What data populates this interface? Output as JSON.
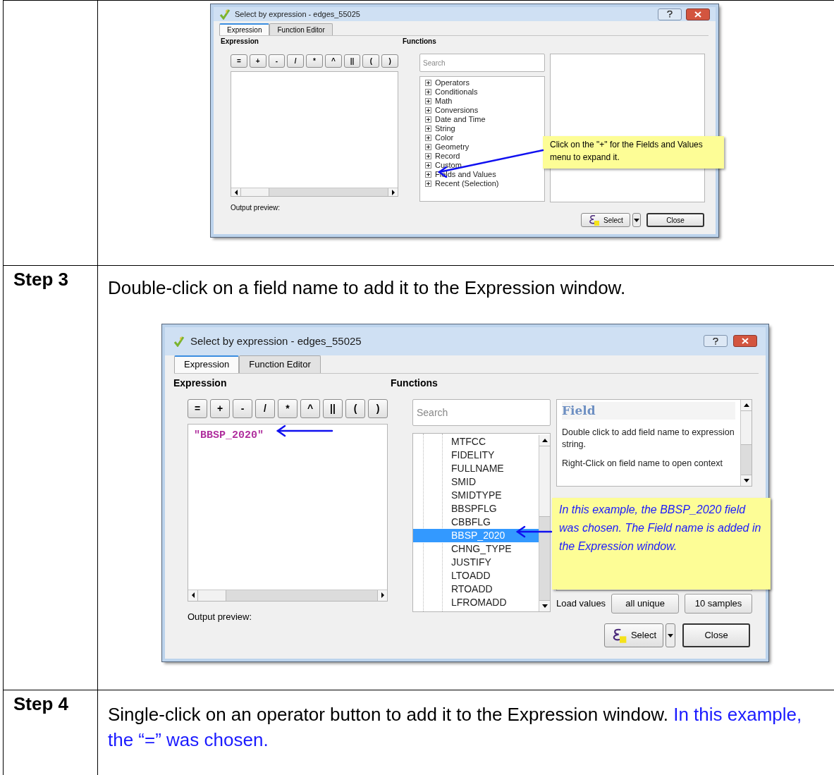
{
  "rows": [
    {
      "dialog": {
        "title": "Select by expression - edges_55025",
        "tabs": [
          {
            "label": "Expression",
            "selected": true
          },
          {
            "label": "Function Editor",
            "selected": false
          }
        ],
        "expression_label": "Expression",
        "functions_label": "Functions",
        "operators": [
          "=",
          "+",
          "-",
          "/",
          "*",
          "^",
          "||",
          "(",
          ")"
        ],
        "search": {
          "placeholder": "Search"
        },
        "tree": [
          {
            "kind": "group",
            "label": "Operators",
            "expanded": false
          },
          {
            "kind": "group",
            "label": "Conditionals",
            "expanded": false
          },
          {
            "kind": "group",
            "label": "Math",
            "expanded": false
          },
          {
            "kind": "group",
            "label": "Conversions",
            "expanded": false
          },
          {
            "kind": "group",
            "label": "Date and Time",
            "expanded": false
          },
          {
            "kind": "group",
            "label": "String",
            "expanded": false
          },
          {
            "kind": "group",
            "label": "Color",
            "expanded": false
          },
          {
            "kind": "group",
            "label": "Geometry",
            "expanded": false
          },
          {
            "kind": "group",
            "label": "Record",
            "expanded": false
          },
          {
            "kind": "group",
            "label": "Custom",
            "expanded": false
          },
          {
            "kind": "group",
            "label": "Fields and Values",
            "expanded": false
          },
          {
            "kind": "group",
            "label": "Recent (Selection)",
            "expanded": false
          }
        ],
        "output_preview_label": "Output preview:",
        "buttons": [
          "Select",
          "Close"
        ],
        "callout": "Click on the  \"+\" for the Fields and Values menu to expand it."
      }
    },
    {
      "step_label": "Step 3",
      "instruction": "Double-click on a field name to add it to the Expression window.",
      "dialog": {
        "title": "Select by expression - edges_55025",
        "tabs": [
          {
            "label": "Expression",
            "selected": true
          },
          {
            "label": "Function Editor",
            "selected": false
          }
        ],
        "expression_label": "Expression",
        "functions_label": "Functions",
        "operators": [
          "=",
          "+",
          "-",
          "/",
          "*",
          "^",
          "||",
          "(",
          ")"
        ],
        "expression_text": "\"BBSP_2020\"",
        "search": {
          "placeholder": "Search"
        },
        "tree": [
          {
            "kind": "field",
            "label": "MTFCC",
            "selected": false
          },
          {
            "kind": "field",
            "label": "FIDELITY",
            "selected": false
          },
          {
            "kind": "field",
            "label": "FULLNAME",
            "selected": false
          },
          {
            "kind": "field",
            "label": "SMID",
            "selected": false
          },
          {
            "kind": "field",
            "label": "SMIDTYPE",
            "selected": false
          },
          {
            "kind": "field",
            "label": "BBSPFLG",
            "selected": false
          },
          {
            "kind": "field",
            "label": "CBBFLG",
            "selected": false
          },
          {
            "kind": "field",
            "label": "BBSP_2020",
            "selected": true
          },
          {
            "kind": "field",
            "label": "CHNG_TYPE",
            "selected": false
          },
          {
            "kind": "field",
            "label": "JUSTIFY",
            "selected": false
          },
          {
            "kind": "field",
            "label": "LTOADD",
            "selected": false
          },
          {
            "kind": "field",
            "label": "RTOADD",
            "selected": false
          },
          {
            "kind": "field",
            "label": "LFROMADD",
            "selected": false
          }
        ],
        "help": {
          "heading": "Field",
          "paragraphs": [
            "Double click to add field name to expression string.",
            "Right-Click on field name to open context"
          ]
        },
        "load_values": {
          "label": "Load values",
          "buttons": [
            "all unique",
            "10 samples"
          ]
        },
        "output_preview_label": "Output preview:",
        "buttons": [
          "Select",
          "Close"
        ],
        "callout": "In this example, the BBSP_2020 field was chosen. The Field name is added in the Expression window."
      }
    },
    {
      "step_label": "Step 4",
      "instruction": "Single-click on an operator button to add it to the Expression window.",
      "note": "In this example, the “=” was chosen."
    }
  ]
}
